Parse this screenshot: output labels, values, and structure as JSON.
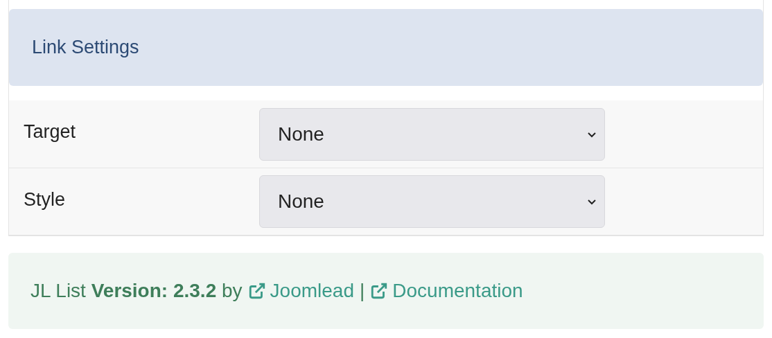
{
  "section": {
    "title": "Link Settings"
  },
  "fields": [
    {
      "label": "Target",
      "value": "None"
    },
    {
      "label": "Style",
      "value": "None"
    }
  ],
  "footer": {
    "credit": "JL List **Version: 2.3.2** by",
    "links": [
      "Joomlead",
      "Documentation"
    ],
    "separator": "|"
  }
}
